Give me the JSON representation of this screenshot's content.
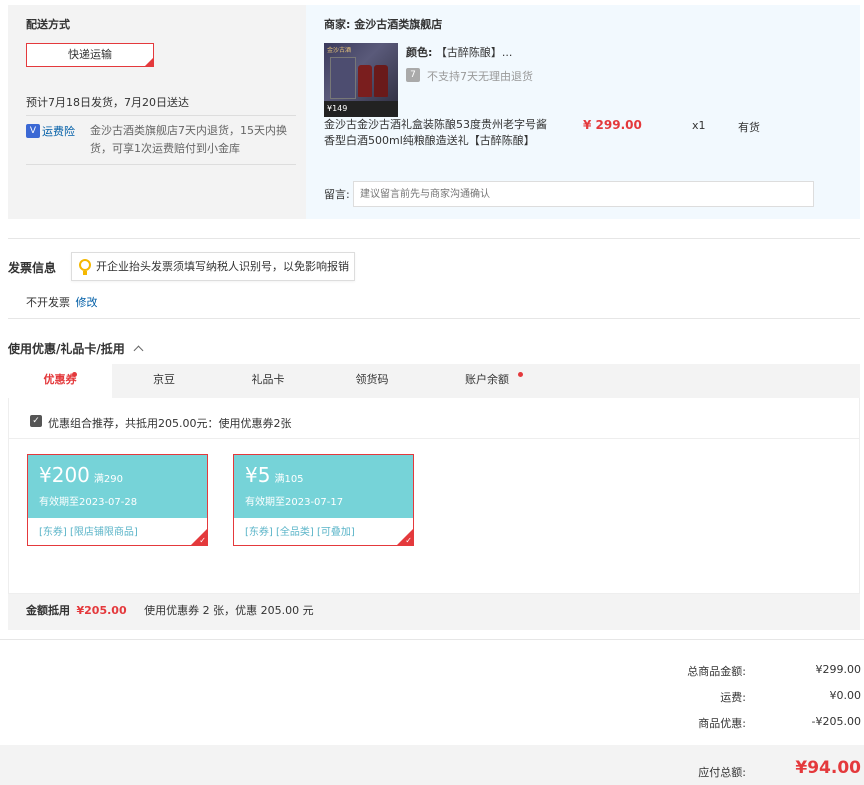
{
  "shipping": {
    "title": "配送方式",
    "method": "快递运输",
    "date_text": "预计7月18日发货，7月20日送达",
    "insurance_icon": "V",
    "insurance_link": "运费险",
    "insurance_desc": "金沙古酒类旗舰店7天内退货，15天内换货，可享1次运费赔付到小金库"
  },
  "merchant": {
    "label": "商家:",
    "name": "金沙古酒类旗舰店"
  },
  "product": {
    "color_label": "颜色:",
    "color_value": "【古醉陈酿】...",
    "no_return_icon": "7",
    "no_return_text": "不支持7天无理由退货",
    "name": "金沙古金沙古酒礼盒装陈酿53度贵州老字号酱香型白酒500ml纯粮酿造送礼【古醉陈酿】",
    "price": "¥ 299.00",
    "qty": "x1",
    "stock": "有货",
    "img_badge": "¥149",
    "img_logo": "金沙古酒"
  },
  "message": {
    "label": "留言:",
    "placeholder": "建议留言前先与商家沟通确认"
  },
  "invoice": {
    "title": "发票信息",
    "tip": "开企业抬头发票须填写纳税人识别号，以免影响报销",
    "value": "不开发票",
    "edit": "修改"
  },
  "discount": {
    "title": "使用优惠/礼品卡/抵用",
    "tabs": [
      {
        "label": "优惠券",
        "dot": true
      },
      {
        "label": "京豆",
        "dot": false
      },
      {
        "label": "礼品卡",
        "dot": false
      },
      {
        "label": "领货码",
        "dot": false
      },
      {
        "label": "账户余额",
        "dot": true
      }
    ],
    "recommend_text": "优惠组合推荐，共抵用205.00元：使用优惠券2张",
    "coupons": [
      {
        "amount": "¥200",
        "condition": "满290",
        "expire": "有效期至2023-07-28",
        "tags": "[东券] [限店铺限商品]"
      },
      {
        "amount": "¥5",
        "condition": "满105",
        "expire": "有效期至2023-07-17",
        "tags": "[东券] [全品类] [可叠加]"
      }
    ],
    "summary_label": "金额抵用",
    "summary_amount": "¥205.00",
    "summary_desc": "使用优惠券 2 张，优惠 205.00 元"
  },
  "totals": {
    "rows": [
      {
        "label": "总商品金额:",
        "value": "¥299.00"
      },
      {
        "label": "运费:",
        "value": "¥0.00"
      },
      {
        "label": "商品优惠:",
        "value": "-¥205.00"
      }
    ],
    "pay_label": "应付总额:",
    "pay_value": "¥94.00"
  },
  "colors": {
    "accent": "#e4393c",
    "link": "#005ea7",
    "coupon_bg": "#76d3d8",
    "panel_gray": "#f3f3f3",
    "panel_blue": "#f2f9fe"
  }
}
